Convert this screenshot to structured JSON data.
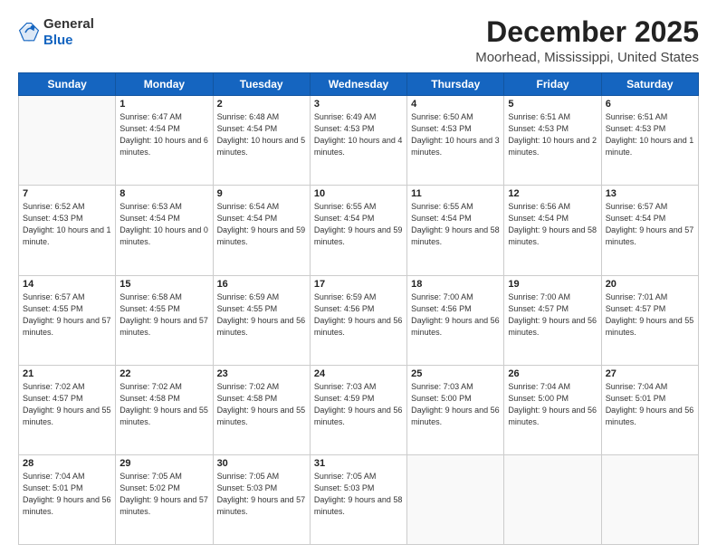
{
  "header": {
    "logo_general": "General",
    "logo_blue": "Blue",
    "title": "December 2025",
    "subtitle": "Moorhead, Mississippi, United States"
  },
  "days_of_week": [
    "Sunday",
    "Monday",
    "Tuesday",
    "Wednesday",
    "Thursday",
    "Friday",
    "Saturday"
  ],
  "weeks": [
    [
      {
        "day": "",
        "sunrise": "",
        "sunset": "",
        "daylight": "",
        "empty": true
      },
      {
        "day": "1",
        "sunrise": "Sunrise: 6:47 AM",
        "sunset": "Sunset: 4:54 PM",
        "daylight": "Daylight: 10 hours and 6 minutes."
      },
      {
        "day": "2",
        "sunrise": "Sunrise: 6:48 AM",
        "sunset": "Sunset: 4:54 PM",
        "daylight": "Daylight: 10 hours and 5 minutes."
      },
      {
        "day": "3",
        "sunrise": "Sunrise: 6:49 AM",
        "sunset": "Sunset: 4:53 PM",
        "daylight": "Daylight: 10 hours and 4 minutes."
      },
      {
        "day": "4",
        "sunrise": "Sunrise: 6:50 AM",
        "sunset": "Sunset: 4:53 PM",
        "daylight": "Daylight: 10 hours and 3 minutes."
      },
      {
        "day": "5",
        "sunrise": "Sunrise: 6:51 AM",
        "sunset": "Sunset: 4:53 PM",
        "daylight": "Daylight: 10 hours and 2 minutes."
      },
      {
        "day": "6",
        "sunrise": "Sunrise: 6:51 AM",
        "sunset": "Sunset: 4:53 PM",
        "daylight": "Daylight: 10 hours and 1 minute."
      }
    ],
    [
      {
        "day": "7",
        "sunrise": "Sunrise: 6:52 AM",
        "sunset": "Sunset: 4:53 PM",
        "daylight": "Daylight: 10 hours and 1 minute."
      },
      {
        "day": "8",
        "sunrise": "Sunrise: 6:53 AM",
        "sunset": "Sunset: 4:54 PM",
        "daylight": "Daylight: 10 hours and 0 minutes."
      },
      {
        "day": "9",
        "sunrise": "Sunrise: 6:54 AM",
        "sunset": "Sunset: 4:54 PM",
        "daylight": "Daylight: 9 hours and 59 minutes."
      },
      {
        "day": "10",
        "sunrise": "Sunrise: 6:55 AM",
        "sunset": "Sunset: 4:54 PM",
        "daylight": "Daylight: 9 hours and 59 minutes."
      },
      {
        "day": "11",
        "sunrise": "Sunrise: 6:55 AM",
        "sunset": "Sunset: 4:54 PM",
        "daylight": "Daylight: 9 hours and 58 minutes."
      },
      {
        "day": "12",
        "sunrise": "Sunrise: 6:56 AM",
        "sunset": "Sunset: 4:54 PM",
        "daylight": "Daylight: 9 hours and 58 minutes."
      },
      {
        "day": "13",
        "sunrise": "Sunrise: 6:57 AM",
        "sunset": "Sunset: 4:54 PM",
        "daylight": "Daylight: 9 hours and 57 minutes."
      }
    ],
    [
      {
        "day": "14",
        "sunrise": "Sunrise: 6:57 AM",
        "sunset": "Sunset: 4:55 PM",
        "daylight": "Daylight: 9 hours and 57 minutes."
      },
      {
        "day": "15",
        "sunrise": "Sunrise: 6:58 AM",
        "sunset": "Sunset: 4:55 PM",
        "daylight": "Daylight: 9 hours and 57 minutes."
      },
      {
        "day": "16",
        "sunrise": "Sunrise: 6:59 AM",
        "sunset": "Sunset: 4:55 PM",
        "daylight": "Daylight: 9 hours and 56 minutes."
      },
      {
        "day": "17",
        "sunrise": "Sunrise: 6:59 AM",
        "sunset": "Sunset: 4:56 PM",
        "daylight": "Daylight: 9 hours and 56 minutes."
      },
      {
        "day": "18",
        "sunrise": "Sunrise: 7:00 AM",
        "sunset": "Sunset: 4:56 PM",
        "daylight": "Daylight: 9 hours and 56 minutes."
      },
      {
        "day": "19",
        "sunrise": "Sunrise: 7:00 AM",
        "sunset": "Sunset: 4:57 PM",
        "daylight": "Daylight: 9 hours and 56 minutes."
      },
      {
        "day": "20",
        "sunrise": "Sunrise: 7:01 AM",
        "sunset": "Sunset: 4:57 PM",
        "daylight": "Daylight: 9 hours and 55 minutes."
      }
    ],
    [
      {
        "day": "21",
        "sunrise": "Sunrise: 7:02 AM",
        "sunset": "Sunset: 4:57 PM",
        "daylight": "Daylight: 9 hours and 55 minutes."
      },
      {
        "day": "22",
        "sunrise": "Sunrise: 7:02 AM",
        "sunset": "Sunset: 4:58 PM",
        "daylight": "Daylight: 9 hours and 55 minutes."
      },
      {
        "day": "23",
        "sunrise": "Sunrise: 7:02 AM",
        "sunset": "Sunset: 4:58 PM",
        "daylight": "Daylight: 9 hours and 55 minutes."
      },
      {
        "day": "24",
        "sunrise": "Sunrise: 7:03 AM",
        "sunset": "Sunset: 4:59 PM",
        "daylight": "Daylight: 9 hours and 56 minutes."
      },
      {
        "day": "25",
        "sunrise": "Sunrise: 7:03 AM",
        "sunset": "Sunset: 5:00 PM",
        "daylight": "Daylight: 9 hours and 56 minutes."
      },
      {
        "day": "26",
        "sunrise": "Sunrise: 7:04 AM",
        "sunset": "Sunset: 5:00 PM",
        "daylight": "Daylight: 9 hours and 56 minutes."
      },
      {
        "day": "27",
        "sunrise": "Sunrise: 7:04 AM",
        "sunset": "Sunset: 5:01 PM",
        "daylight": "Daylight: 9 hours and 56 minutes."
      }
    ],
    [
      {
        "day": "28",
        "sunrise": "Sunrise: 7:04 AM",
        "sunset": "Sunset: 5:01 PM",
        "daylight": "Daylight: 9 hours and 56 minutes."
      },
      {
        "day": "29",
        "sunrise": "Sunrise: 7:05 AM",
        "sunset": "Sunset: 5:02 PM",
        "daylight": "Daylight: 9 hours and 57 minutes."
      },
      {
        "day": "30",
        "sunrise": "Sunrise: 7:05 AM",
        "sunset": "Sunset: 5:03 PM",
        "daylight": "Daylight: 9 hours and 57 minutes."
      },
      {
        "day": "31",
        "sunrise": "Sunrise: 7:05 AM",
        "sunset": "Sunset: 5:03 PM",
        "daylight": "Daylight: 9 hours and 58 minutes."
      },
      {
        "day": "",
        "sunrise": "",
        "sunset": "",
        "daylight": "",
        "empty": true
      },
      {
        "day": "",
        "sunrise": "",
        "sunset": "",
        "daylight": "",
        "empty": true
      },
      {
        "day": "",
        "sunrise": "",
        "sunset": "",
        "daylight": "",
        "empty": true
      }
    ]
  ]
}
